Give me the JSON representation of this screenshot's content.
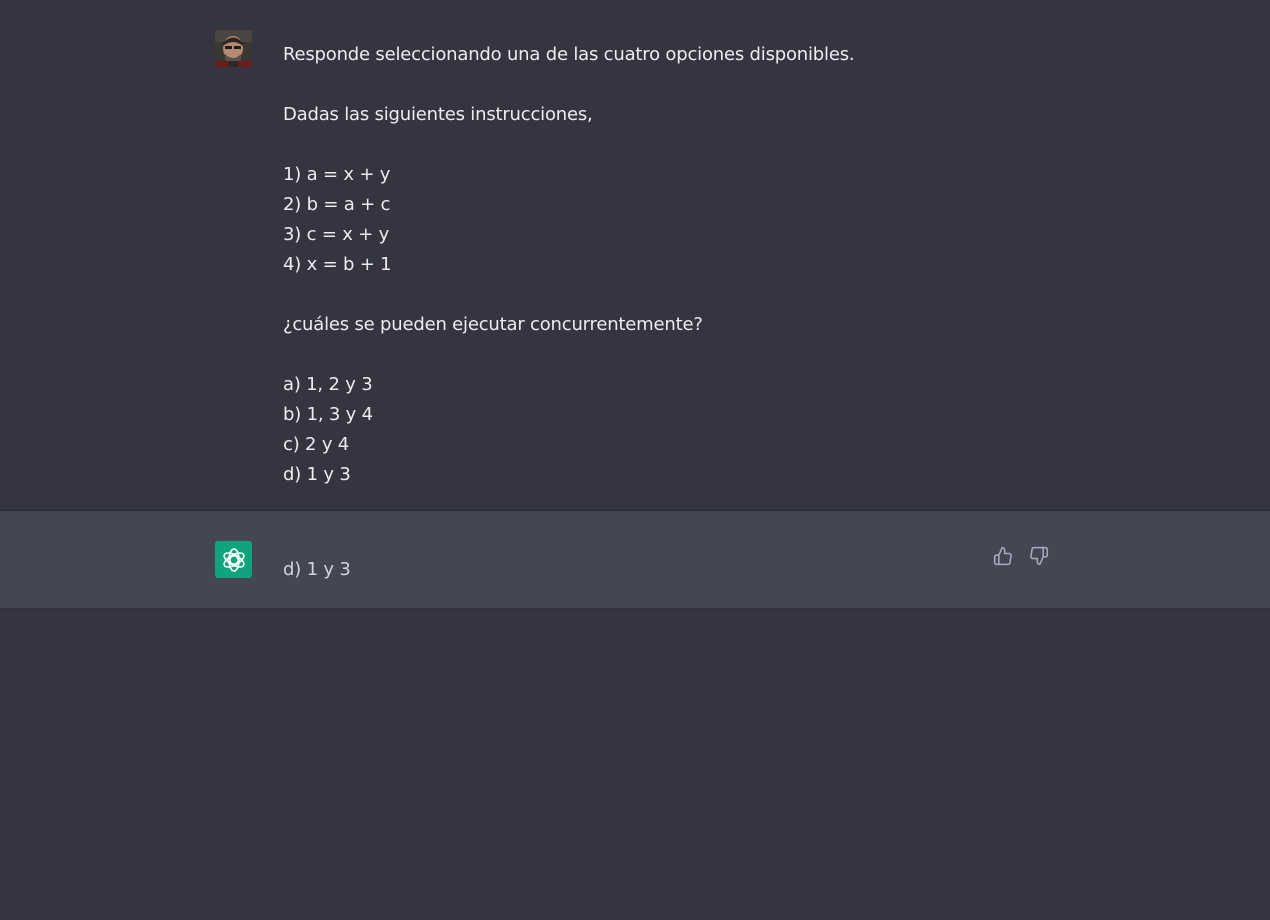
{
  "conversation": {
    "user": {
      "avatar_icon": "user-avatar-photo",
      "paragraphs": [
        [
          "Responde seleccionando una de las cuatro opciones disponibles."
        ],
        [
          "Dadas las siguientes instrucciones,"
        ],
        [
          "1) a = x + y",
          "2) b = a + c",
          "3) c = x + y",
          "4) x = b + 1"
        ],
        [
          "¿cuáles se pueden ejecutar concurrentemente?"
        ],
        [
          "a) 1, 2 y 3",
          "b) 1, 3 y 4",
          "c) 2 y 4",
          "d) 1 y 3"
        ]
      ]
    },
    "assistant": {
      "avatar_icon": "openai-logo-icon",
      "answer": "d) 1 y 3",
      "feedback": {
        "thumbs_up_icon": "thumbs-up-icon",
        "thumbs_down_icon": "thumbs-down-icon"
      }
    }
  },
  "colors": {
    "background": "#343541",
    "assistant_background": "#444654",
    "text": "#ececf1",
    "assistant_text": "#d1d5db",
    "brand": "#10a37f"
  }
}
